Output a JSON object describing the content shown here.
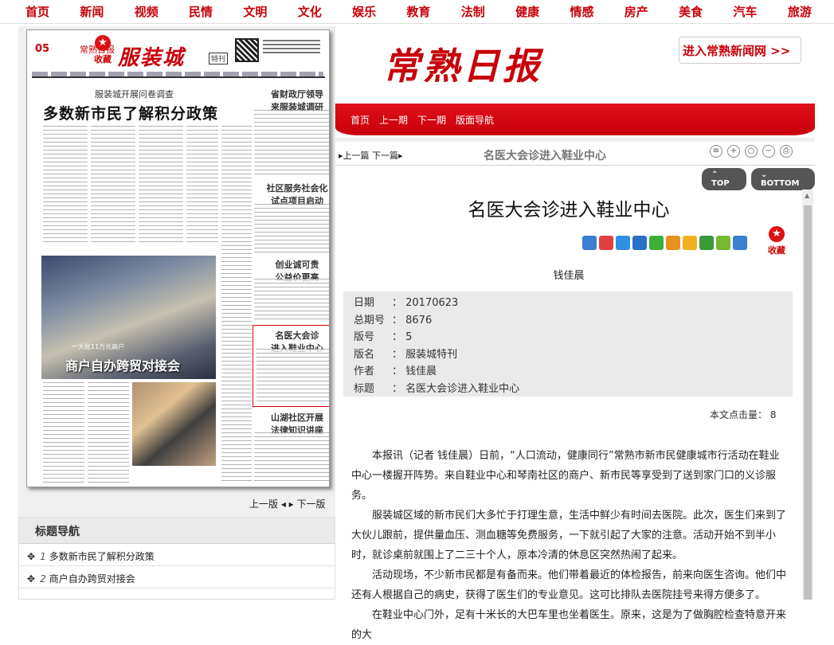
{
  "topnav": [
    "首页",
    "新闻",
    "视频",
    "民情",
    "文明",
    "文化",
    "娱乐",
    "教育",
    "法制",
    "健康",
    "情感",
    "房产",
    "美食",
    "汽车",
    "旅游"
  ],
  "paper": {
    "fav": "收藏",
    "page_no": "05",
    "masthead_small": "常熟日报",
    "title": "服装城",
    "tag": "特刊",
    "lead_sub": "服装城开展问卷调查",
    "lead_title": "多数新市民了解积分政策",
    "side_heads": [
      "省财政厅领导\n来服装城调研",
      "社区服务社会化\n试点项目启动",
      "创业诚可贵\n公益价更高",
      "名医大会诊\n进入鞋业中心",
      "山湖社区开展\n法律知识讲座"
    ],
    "photo_caption": "一大批11万元商户",
    "photo_title": "商户自办跨贸对接会"
  },
  "pager": {
    "prev": "上一版",
    "next": "下一版"
  },
  "index": {
    "title": "标题导航",
    "items": [
      {
        "num": "1",
        "text": "多数新市民了解积分政策"
      },
      {
        "num": "2",
        "text": "商户自办跨贸对接会"
      }
    ]
  },
  "banner": {
    "brand": "常熟日报",
    "go_site": "进入常熟新闻网 >>",
    "links": [
      "首页",
      "上一期",
      "下一期",
      "版面导航"
    ]
  },
  "article": {
    "nav_prev": "上一篇",
    "nav_next": "下一篇",
    "bar_title": "名医大会诊进入鞋业中心",
    "top": "TOP",
    "bottom": "BOTTOM",
    "headline": "名医大会诊进入鞋业中心",
    "fav": "收藏",
    "author": "钱佳晨",
    "meta": [
      {
        "k": "日期",
        "v": "20170623"
      },
      {
        "k": "总期号",
        "v": "8676"
      },
      {
        "k": "版号",
        "v": "5"
      },
      {
        "k": "版名",
        "v": "服装城特刊"
      },
      {
        "k": "作者",
        "v": "钱佳晨"
      },
      {
        "k": "标题",
        "v": "名医大会诊进入鞋业中心"
      }
    ],
    "hits": "本文点击量： 8",
    "paragraphs": [
      "本报讯（记者 钱佳晨）日前，“人口流动，健康同行”常熟市新市民健康城市行活动在鞋业中心一楼握开阵势。来自鞋业中心和琴南社区的商户、新市民等享受到了送到家门口的义诊服务。",
      "服装城区域的新市民们大多忙于打理生意，生活中鲜少有时间去医院。此次，医生们来到了大伙儿跟前，提供量血压、测血糖等免费服务，一下就引起了大家的注意。活动开始不到半小时，就诊桌前就围上了二三十个人，原本冷清的休息区突然热闹了起来。",
      "活动现场，不少新市民都是有备而来。他们带着最近的体检报告，前来向医生咨询。他们中还有人根据自己的病史，获得了医生们的专业意见。这可比排队去医院挂号来得方便多了。",
      "在鞋业中心门外，足有十米长的大巴车里也坐着医生。原来，这是为了做胸腔检查特意开来的大"
    ]
  },
  "colors": {
    "accent": "#c8000a"
  }
}
